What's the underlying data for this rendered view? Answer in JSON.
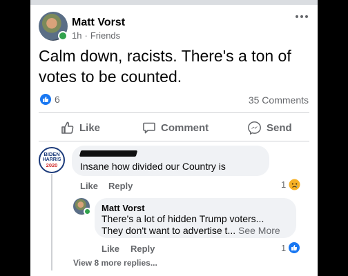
{
  "post": {
    "author": "Matt Vorst",
    "time": "1h",
    "separator": "·",
    "audience": "Friends",
    "text": "Calm down, racists. There's a ton of votes to be counted.",
    "reaction_count": "6",
    "comment_count": "35 Comments"
  },
  "actions": {
    "like": "Like",
    "comment": "Comment",
    "send": "Send"
  },
  "comment1": {
    "author_redacted": true,
    "avatar_logo": [
      "BIDEN",
      "HARRIS",
      "2020"
    ],
    "text": "Insane how divided our Country is",
    "like": "Like",
    "reply": "Reply",
    "reaction_count": "1",
    "reaction_icon": "sad-emoji"
  },
  "reply1": {
    "author": "Matt Vorst",
    "line1": "There's a lot of hidden Trump voters...",
    "line2": "They don't want to advertise t...",
    "see_more": "See More",
    "like": "Like",
    "reply": "Reply",
    "reaction_count": "1",
    "reaction_icon": "like-emoji"
  },
  "more_replies": "View 8 more replies...",
  "colors": {
    "accent": "#1877f2",
    "online": "#31a24c",
    "muted": "#65676b",
    "bubble": "#f0f2f5"
  }
}
